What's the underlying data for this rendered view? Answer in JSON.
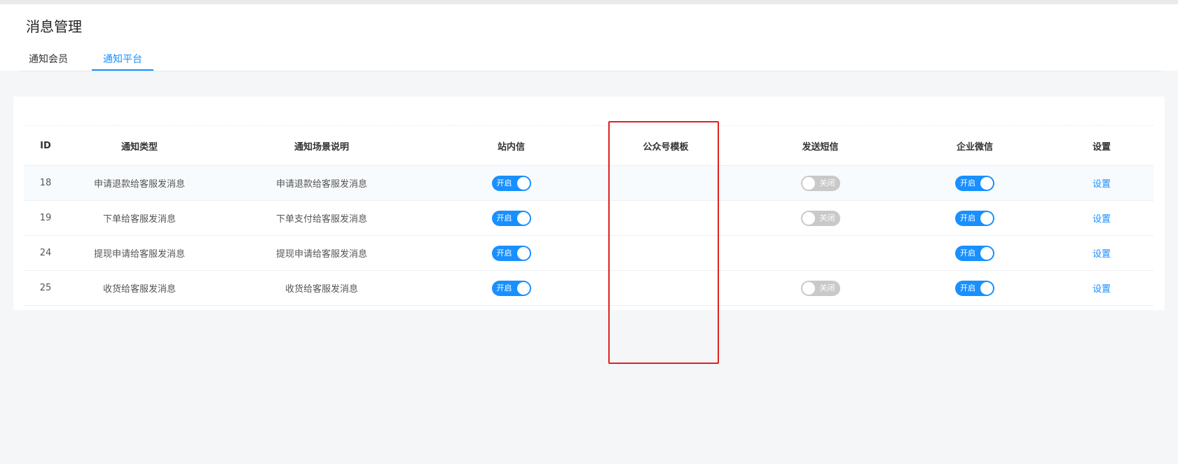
{
  "page": {
    "title": "消息管理",
    "tabs": [
      {
        "label": "通知会员",
        "active": false
      },
      {
        "label": "通知平台",
        "active": true
      }
    ]
  },
  "colors": {
    "accent": "#1890ff",
    "switch_off": "#c9c9c9",
    "highlight": "#e02020"
  },
  "table": {
    "headers": [
      "ID",
      "通知类型",
      "通知场景说明",
      "站内信",
      "公众号模板",
      "发送短信",
      "企业微信",
      "设置"
    ],
    "rows": [
      {
        "id": "18",
        "type": "申请退款给客服发消息",
        "desc": "申请退款给客服发消息",
        "site": {
          "on": true,
          "label": "开启"
        },
        "mp": null,
        "sms": {
          "on": false,
          "label": "关闭"
        },
        "wecom": {
          "on": true,
          "label": "开启"
        },
        "action": "设置"
      },
      {
        "id": "19",
        "type": "下单给客服发消息",
        "desc": "下单支付给客服发消息",
        "site": {
          "on": true,
          "label": "开启"
        },
        "mp": null,
        "sms": {
          "on": false,
          "label": "关闭"
        },
        "wecom": {
          "on": true,
          "label": "开启"
        },
        "action": "设置"
      },
      {
        "id": "24",
        "type": "提现申请给客服发消息",
        "desc": "提现申请给客服发消息",
        "site": {
          "on": true,
          "label": "开启"
        },
        "mp": null,
        "sms": null,
        "wecom": {
          "on": true,
          "label": "开启"
        },
        "action": "设置"
      },
      {
        "id": "25",
        "type": "收货给客服发消息",
        "desc": "收货给客服发消息",
        "site": {
          "on": true,
          "label": "开启"
        },
        "mp": null,
        "sms": {
          "on": false,
          "label": "关闭"
        },
        "wecom": {
          "on": true,
          "label": "开启"
        },
        "action": "设置"
      }
    ]
  }
}
